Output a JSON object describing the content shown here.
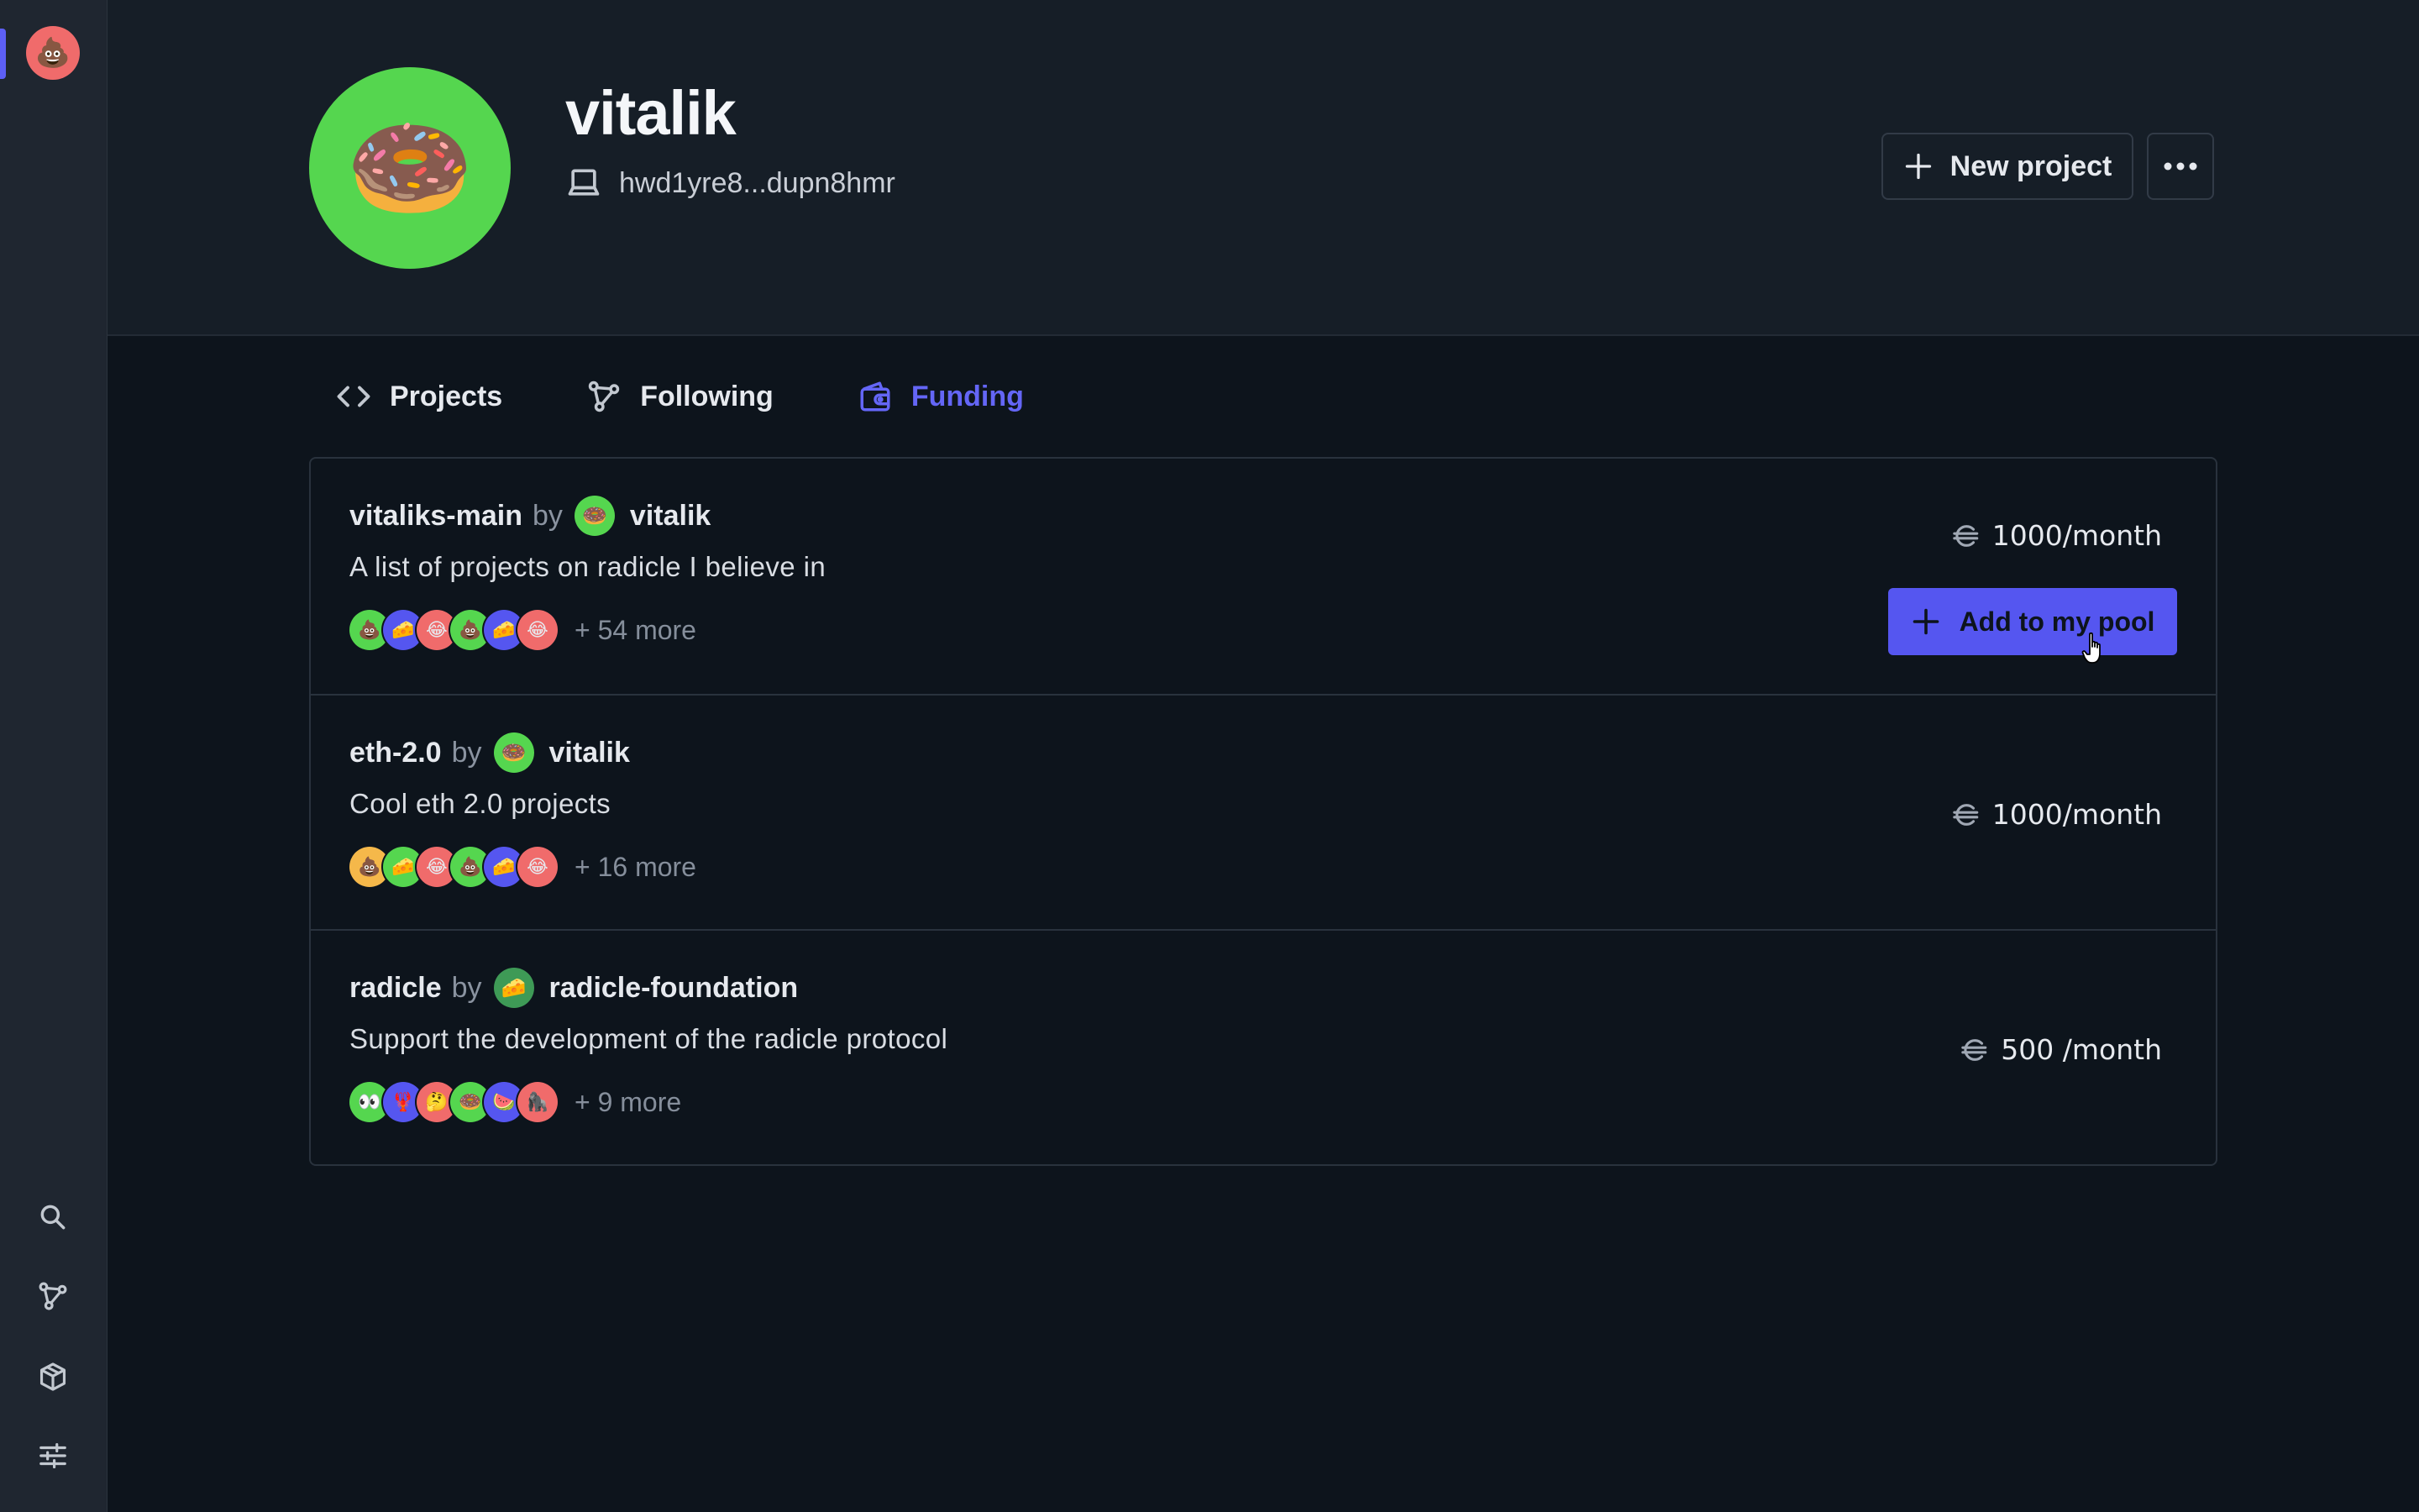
{
  "colors": {
    "accent": "#5d5ff5",
    "background": "#0d141c",
    "header_bg": "#161e27",
    "sidebar_bg": "#1f2630",
    "profile_avatar_bg": "#55d64f",
    "user_avatar_bg": "#f06b6b"
  },
  "sidebar": {
    "user_avatar_emoji": "💩",
    "items": [
      {
        "icon": "search-icon"
      },
      {
        "icon": "network-icon"
      },
      {
        "icon": "box-icon"
      },
      {
        "icon": "settings-sliders-icon"
      }
    ]
  },
  "profile": {
    "avatar_emoji": "🍩",
    "name": "vitalik",
    "device_id": "hwd1yre8...dupn8hmr",
    "new_project_label": "New project"
  },
  "tabs": [
    {
      "label": "Projects",
      "icon": "code-icon",
      "active": false
    },
    {
      "label": "Following",
      "icon": "network-icon",
      "active": false
    },
    {
      "label": "Funding",
      "icon": "wallet-icon",
      "active": true
    }
  ],
  "pools": [
    {
      "name": "vitaliks-main",
      "by": "by",
      "owner": "vitalik",
      "owner_emoji": "🍩",
      "description": "A list of projects on radicle I believe in",
      "member_emojis": [
        "💩",
        "🧀",
        "😂",
        "💩",
        "🧀",
        "😂"
      ],
      "more": "+ 54 more",
      "amount": "1000/month",
      "action_label": "Add to my pool"
    },
    {
      "name": "eth-2.0",
      "by": "by",
      "owner": "vitalik",
      "owner_emoji": "🍩",
      "description": "Cool eth 2.0 projects",
      "member_emojis": [
        "💩",
        "🧀",
        "😂",
        "💩",
        "🧀",
        "😂"
      ],
      "more": "+ 16 more",
      "amount": "1000/month"
    },
    {
      "name": "radicle",
      "by": "by",
      "owner": "radicle-foundation",
      "owner_emoji": "🧀",
      "description": "Support the development of the radicle protocol",
      "member_emojis": [
        "👀",
        "🦞",
        "🤔",
        "🍩",
        "🍉",
        "🦍"
      ],
      "more": "+ 9 more",
      "amount": "500 /month"
    }
  ]
}
